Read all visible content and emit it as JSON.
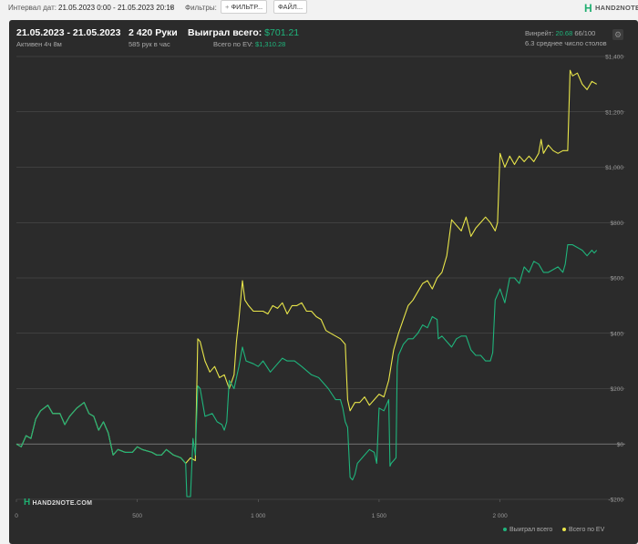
{
  "toolbar": {
    "interval_label": "Интервал дат:",
    "interval_value": "21.05.2023 0:00 - 21.05.2023 20:18",
    "filters_label": "Фильтры:",
    "filter_button": "ФИЛЬТР...",
    "file_button": "ФАЙЛ...",
    "logo_text": "HAND2NOTE.COM"
  },
  "header": {
    "date_range": "21.05.2023 - 21.05.2023",
    "active": "Активен 4ч 8м",
    "hands": "2 420 Руки",
    "hands_per_hour": "585 рук в час",
    "won_label": "Выиграл всего:",
    "won_value": "$701.21",
    "ev_label": "Всего по EV:",
    "ev_value": "$1,310.28",
    "winrate_label": "Винрейт:",
    "winrate_value": "20.68",
    "winrate_rest": "66/100",
    "tables": "6.3 среднее число столов"
  },
  "watermark": "HAND2NOTE.COM",
  "colors": {
    "won": "#1fb57c",
    "ev": "#e9e64a",
    "grid": "#555555",
    "zero": "#8a8a8a"
  },
  "chart_data": {
    "type": "line",
    "xlim": [
      0,
      2420
    ],
    "ylim": [
      -200,
      1400
    ],
    "x_ticks": [
      0,
      500,
      1000,
      1500,
      2000
    ],
    "x_tick_labels": [
      "0",
      "500",
      "1 000",
      "1 500",
      "2 000"
    ],
    "y_ticks": [
      -200,
      0,
      200,
      400,
      600,
      800,
      1000,
      1200,
      1400
    ],
    "y_tick_labels": [
      "-$200",
      "$0",
      "$200",
      "$400",
      "$600",
      "$800",
      "$1,000",
      "$1,200",
      "$1,400"
    ],
    "legend_position": "bottom-right",
    "series": [
      {
        "name": "Выиграл всего",
        "points": [
          [
            0,
            0
          ],
          [
            20,
            -10
          ],
          [
            40,
            30
          ],
          [
            60,
            20
          ],
          [
            80,
            90
          ],
          [
            100,
            120
          ],
          [
            130,
            140
          ],
          [
            150,
            110
          ],
          [
            180,
            110
          ],
          [
            200,
            70
          ],
          [
            220,
            100
          ],
          [
            250,
            130
          ],
          [
            280,
            150
          ],
          [
            300,
            110
          ],
          [
            320,
            100
          ],
          [
            340,
            50
          ],
          [
            360,
            80
          ],
          [
            380,
            40
          ],
          [
            400,
            -40
          ],
          [
            420,
            -20
          ],
          [
            450,
            -30
          ],
          [
            480,
            -30
          ],
          [
            500,
            -10
          ],
          [
            520,
            -20
          ],
          [
            560,
            -30
          ],
          [
            580,
            -40
          ],
          [
            600,
            -40
          ],
          [
            620,
            -20
          ],
          [
            650,
            -40
          ],
          [
            680,
            -50
          ],
          [
            700,
            -70
          ],
          [
            705,
            -190
          ],
          [
            720,
            -190
          ],
          [
            730,
            20
          ],
          [
            740,
            -40
          ],
          [
            750,
            210
          ],
          [
            760,
            200
          ],
          [
            780,
            100
          ],
          [
            810,
            110
          ],
          [
            830,
            80
          ],
          [
            850,
            70
          ],
          [
            860,
            50
          ],
          [
            870,
            80
          ],
          [
            880,
            230
          ],
          [
            900,
            200
          ],
          [
            920,
            280
          ],
          [
            935,
            350
          ],
          [
            950,
            300
          ],
          [
            980,
            290
          ],
          [
            1000,
            280
          ],
          [
            1020,
            300
          ],
          [
            1050,
            260
          ],
          [
            1070,
            280
          ],
          [
            1100,
            310
          ],
          [
            1120,
            300
          ],
          [
            1150,
            300
          ],
          [
            1180,
            280
          ],
          [
            1220,
            250
          ],
          [
            1250,
            240
          ],
          [
            1270,
            220
          ],
          [
            1290,
            200
          ],
          [
            1320,
            160
          ],
          [
            1340,
            160
          ],
          [
            1350,
            130
          ],
          [
            1360,
            80
          ],
          [
            1370,
            60
          ],
          [
            1380,
            -120
          ],
          [
            1390,
            -130
          ],
          [
            1400,
            -110
          ],
          [
            1410,
            -70
          ],
          [
            1420,
            -60
          ],
          [
            1440,
            -40
          ],
          [
            1460,
            -20
          ],
          [
            1480,
            -30
          ],
          [
            1490,
            -70
          ],
          [
            1500,
            130
          ],
          [
            1520,
            120
          ],
          [
            1540,
            160
          ],
          [
            1545,
            -80
          ],
          [
            1550,
            -70
          ],
          [
            1560,
            -60
          ],
          [
            1570,
            -50
          ],
          [
            1575,
            280
          ],
          [
            1580,
            320
          ],
          [
            1600,
            360
          ],
          [
            1620,
            380
          ],
          [
            1640,
            380
          ],
          [
            1660,
            400
          ],
          [
            1680,
            430
          ],
          [
            1700,
            420
          ],
          [
            1720,
            460
          ],
          [
            1740,
            450
          ],
          [
            1745,
            380
          ],
          [
            1760,
            390
          ],
          [
            1780,
            370
          ],
          [
            1800,
            350
          ],
          [
            1820,
            380
          ],
          [
            1840,
            390
          ],
          [
            1860,
            390
          ],
          [
            1880,
            340
          ],
          [
            1900,
            320
          ],
          [
            1920,
            320
          ],
          [
            1940,
            300
          ],
          [
            1960,
            300
          ],
          [
            1970,
            330
          ],
          [
            1980,
            520
          ],
          [
            2000,
            560
          ],
          [
            2020,
            510
          ],
          [
            2040,
            600
          ],
          [
            2060,
            600
          ],
          [
            2080,
            580
          ],
          [
            2100,
            640
          ],
          [
            2120,
            620
          ],
          [
            2140,
            660
          ],
          [
            2160,
            650
          ],
          [
            2180,
            620
          ],
          [
            2200,
            620
          ],
          [
            2220,
            630
          ],
          [
            2240,
            640
          ],
          [
            2260,
            620
          ],
          [
            2270,
            650
          ],
          [
            2280,
            720
          ],
          [
            2300,
            720
          ],
          [
            2320,
            710
          ],
          [
            2340,
            700
          ],
          [
            2360,
            680
          ],
          [
            2380,
            700
          ],
          [
            2390,
            690
          ],
          [
            2400,
            700
          ]
        ]
      },
      {
        "name": "Всего по EV",
        "points": [
          [
            0,
            0
          ],
          [
            20,
            -10
          ],
          [
            40,
            30
          ],
          [
            60,
            20
          ],
          [
            80,
            90
          ],
          [
            100,
            120
          ],
          [
            130,
            140
          ],
          [
            150,
            110
          ],
          [
            180,
            110
          ],
          [
            200,
            70
          ],
          [
            220,
            100
          ],
          [
            250,
            130
          ],
          [
            280,
            150
          ],
          [
            300,
            110
          ],
          [
            320,
            100
          ],
          [
            340,
            50
          ],
          [
            360,
            80
          ],
          [
            380,
            40
          ],
          [
            400,
            -40
          ],
          [
            420,
            -20
          ],
          [
            450,
            -30
          ],
          [
            480,
            -30
          ],
          [
            500,
            -10
          ],
          [
            520,
            -20
          ],
          [
            560,
            -30
          ],
          [
            580,
            -40
          ],
          [
            600,
            -40
          ],
          [
            620,
            -20
          ],
          [
            650,
            -40
          ],
          [
            680,
            -50
          ],
          [
            700,
            -70
          ],
          [
            720,
            -50
          ],
          [
            740,
            -60
          ],
          [
            750,
            380
          ],
          [
            760,
            370
          ],
          [
            780,
            300
          ],
          [
            800,
            260
          ],
          [
            820,
            280
          ],
          [
            840,
            240
          ],
          [
            860,
            250
          ],
          [
            880,
            200
          ],
          [
            900,
            250
          ],
          [
            910,
            370
          ],
          [
            920,
            450
          ],
          [
            935,
            590
          ],
          [
            945,
            520
          ],
          [
            960,
            500
          ],
          [
            980,
            480
          ],
          [
            1000,
            480
          ],
          [
            1020,
            480
          ],
          [
            1040,
            470
          ],
          [
            1060,
            500
          ],
          [
            1080,
            490
          ],
          [
            1100,
            510
          ],
          [
            1120,
            470
          ],
          [
            1140,
            500
          ],
          [
            1160,
            500
          ],
          [
            1180,
            510
          ],
          [
            1200,
            480
          ],
          [
            1220,
            480
          ],
          [
            1240,
            460
          ],
          [
            1260,
            450
          ],
          [
            1280,
            410
          ],
          [
            1300,
            400
          ],
          [
            1320,
            390
          ],
          [
            1340,
            380
          ],
          [
            1360,
            360
          ],
          [
            1370,
            160
          ],
          [
            1380,
            120
          ],
          [
            1400,
            150
          ],
          [
            1420,
            150
          ],
          [
            1440,
            170
          ],
          [
            1460,
            140
          ],
          [
            1480,
            160
          ],
          [
            1500,
            180
          ],
          [
            1520,
            170
          ],
          [
            1540,
            230
          ],
          [
            1560,
            340
          ],
          [
            1580,
            400
          ],
          [
            1600,
            450
          ],
          [
            1620,
            500
          ],
          [
            1640,
            520
          ],
          [
            1660,
            550
          ],
          [
            1680,
            580
          ],
          [
            1700,
            590
          ],
          [
            1720,
            560
          ],
          [
            1740,
            600
          ],
          [
            1760,
            620
          ],
          [
            1780,
            680
          ],
          [
            1800,
            810
          ],
          [
            1820,
            790
          ],
          [
            1840,
            770
          ],
          [
            1860,
            820
          ],
          [
            1880,
            750
          ],
          [
            1900,
            780
          ],
          [
            1920,
            800
          ],
          [
            1940,
            820
          ],
          [
            1960,
            800
          ],
          [
            1980,
            770
          ],
          [
            1990,
            800
          ],
          [
            2000,
            1050
          ],
          [
            2020,
            1000
          ],
          [
            2040,
            1040
          ],
          [
            2060,
            1010
          ],
          [
            2080,
            1040
          ],
          [
            2100,
            1020
          ],
          [
            2120,
            1040
          ],
          [
            2140,
            1020
          ],
          [
            2160,
            1050
          ],
          [
            2170,
            1100
          ],
          [
            2180,
            1050
          ],
          [
            2200,
            1080
          ],
          [
            2220,
            1060
          ],
          [
            2240,
            1050
          ],
          [
            2260,
            1060
          ],
          [
            2280,
            1060
          ],
          [
            2290,
            1350
          ],
          [
            2300,
            1330
          ],
          [
            2320,
            1340
          ],
          [
            2340,
            1300
          ],
          [
            2360,
            1280
          ],
          [
            2380,
            1310
          ],
          [
            2400,
            1300
          ]
        ]
      }
    ]
  }
}
